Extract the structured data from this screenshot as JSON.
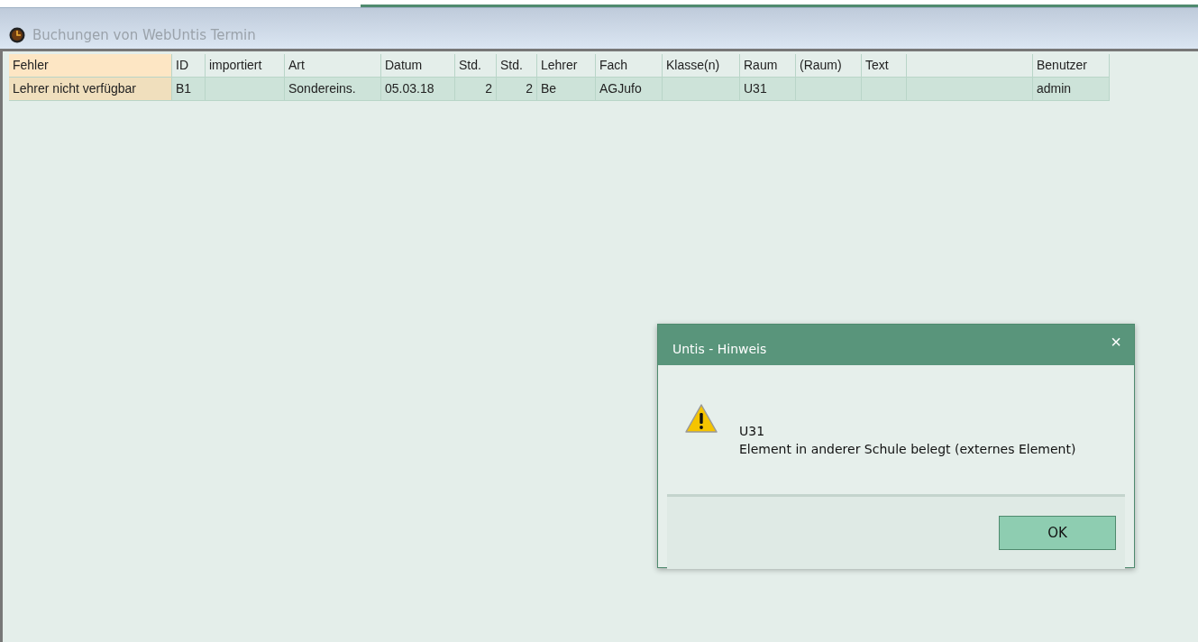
{
  "panel": {
    "title": "Buchungen von WebUntis Termin"
  },
  "table": {
    "columns": [
      {
        "label": "Fehler",
        "kind": "error"
      },
      {
        "label": "ID",
        "kind": "text"
      },
      {
        "label": "importiert",
        "kind": "text"
      },
      {
        "label": "Art",
        "kind": "text"
      },
      {
        "label": "Datum",
        "kind": "text"
      },
      {
        "label": "Std.",
        "kind": "number"
      },
      {
        "label": "Std.",
        "kind": "number"
      },
      {
        "label": "Lehrer",
        "kind": "text"
      },
      {
        "label": "Fach",
        "kind": "text"
      },
      {
        "label": "Klasse(n)",
        "kind": "text"
      },
      {
        "label": "Raum",
        "kind": "text"
      },
      {
        "label": "(Raum)",
        "kind": "text"
      },
      {
        "label": "Text",
        "kind": "text"
      },
      {
        "kind": "text"
      },
      {
        "label": "Benutzer",
        "kind": "text"
      }
    ],
    "rows": [
      {
        "cells": [
          "Lehrer nicht verfügbar",
          "B1",
          null,
          "Sondereins.",
          "05.03.18",
          "2",
          "2",
          "Be",
          "AGJufo",
          null,
          "U31",
          null,
          null,
          null,
          "admin"
        ]
      }
    ]
  },
  "dialog": {
    "title": "Untis - Hinweis",
    "close": "×",
    "message_lines": [
      "U31",
      "Element in anderer Schule belegt (externes Element)"
    ],
    "buttons": [
      "OK"
    ]
  }
}
